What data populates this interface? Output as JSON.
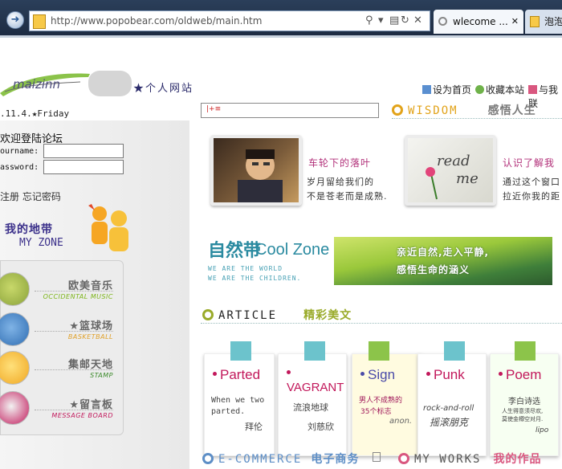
{
  "browser": {
    "url": "http://www.popobear.com/oldweb/main.htm",
    "tabs": [
      {
        "label": "wlecome ...",
        "active": true
      },
      {
        "label": "泡泡",
        "active": false
      }
    ]
  },
  "header": {
    "logo_text": "maizinn",
    "site_title": "★个人网站",
    "links": [
      "设为首页",
      "收藏本站",
      "与我联"
    ]
  },
  "sidebar": {
    "date": ".11.4.★Friday",
    "login_title": "欢迎登陆论坛",
    "username_label": "ourname:",
    "password_label": "assword:",
    "login_links": "注册 忘记密码",
    "myzone_cn": "我的地带",
    "myzone_en": "MY ZONE",
    "menu": [
      {
        "cn": "欧美音乐",
        "en": "OCCIDENTAL MUSIC",
        "en_color": "#7cb518"
      },
      {
        "cn": "★篮球场",
        "en": "BASKETBALL",
        "en_color": "#e0a028"
      },
      {
        "cn": "集邮天地",
        "en": "STAMP",
        "en_color": "#3b8a2a"
      },
      {
        "cn": "★留言板",
        "en": "MESSAGE BOARD",
        "en_color": "#c2185b"
      }
    ]
  },
  "wisdom": {
    "title_en": "WISDOM",
    "title_cn": "感悟人生",
    "cards": [
      {
        "title": "车轮下的落叶",
        "lines": [
          "岁月留给我们的",
          "不是苍老而是成熟."
        ]
      },
      {
        "title": "认识了解我",
        "lines": [
          "通过这个窗口",
          "拉近你我的距"
        ]
      }
    ],
    "thumb_text": [
      "read",
      "me"
    ]
  },
  "coolzone": {
    "cn": "自然带",
    "en": "Cool Zone",
    "lines": [
      "WE ARE THE WORLD",
      "WE ARE THE CHILDREN."
    ],
    "banner_lines": [
      "亲近自然,走入平静,",
      "感悟生命的涵义"
    ]
  },
  "article": {
    "title_en": "ARTICLE",
    "title_cn": "精彩美文",
    "notes": [
      {
        "head": "Parted",
        "head_color": "#c2185b",
        "tape": "#6cc3cc",
        "lines": [
          "When we two",
          "parted.",
          "拜伦"
        ]
      },
      {
        "head": "VAGRANT",
        "head_color": "#c2185b",
        "tape": "#6cc3cc",
        "lines": [
          "流浪地球",
          "刘慈欣"
        ]
      },
      {
        "head": "Sign",
        "head_color": "#4a4aa8",
        "tape": "#8cc44a",
        "lines": [
          "男人不成熟的",
          "35个标志",
          "anon."
        ]
      },
      {
        "head": "Punk",
        "head_color": "#c2185b",
        "tape": "#6cc3cc",
        "lines": [
          "rock-and-roll",
          "摇滚朋克"
        ]
      },
      {
        "head": "Poem",
        "head_color": "#c2185b",
        "tape": "#8cc44a",
        "lines": [
          "李白诗选",
          "人生得意须尽欢,",
          "莫使金樽空对月.",
          "lipo"
        ]
      }
    ]
  },
  "bottom": {
    "ecommerce_en": "E-COMMERCE",
    "ecommerce_cn": "电子商务",
    "works_en": "MY WORKS",
    "works_cn": "我的作品"
  }
}
